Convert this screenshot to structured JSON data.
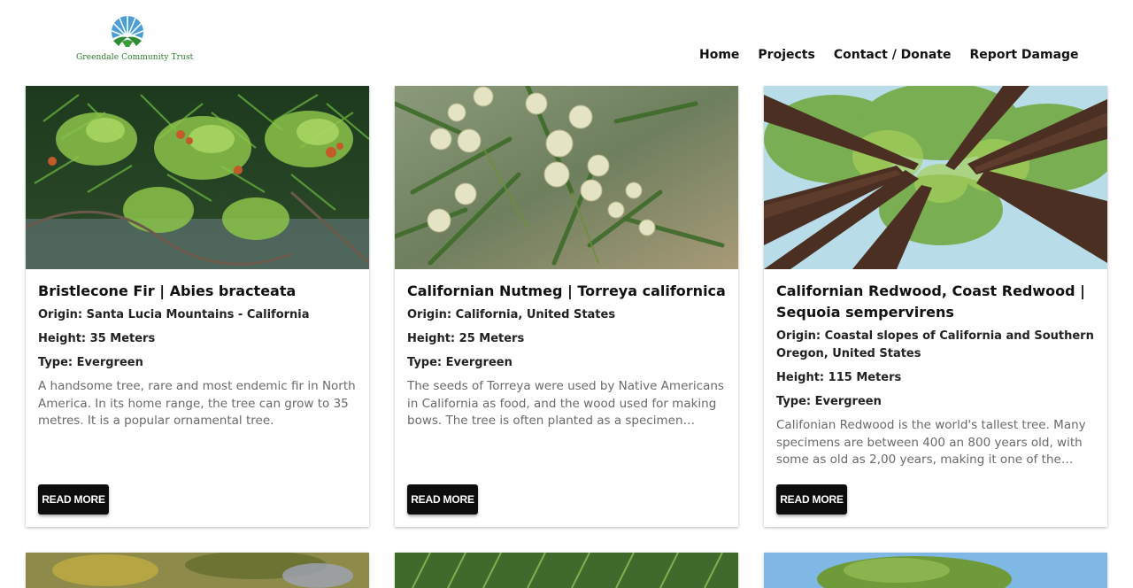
{
  "brand": {
    "logo_text": "Greendale Community Trust"
  },
  "nav": {
    "items": [
      {
        "label": "Home"
      },
      {
        "label": "Projects"
      },
      {
        "label": "Contact / Donate"
      },
      {
        "label": "Report Damage"
      }
    ]
  },
  "cards": [
    {
      "title": "Bristlecone Fir | Abies bracteata",
      "origin": "Origin: Santa Lucia Mountains - California",
      "height": "Height: 35 Meters",
      "type": "Type: Evergreen",
      "description": "A handsome tree, rare and most endemic fir in North America. In its home range, the tree can grow to 35 metres. It is a popular ornamental tree.",
      "button": "READ MORE"
    },
    {
      "title": "Californian Nutmeg | Torreya californica",
      "origin": "Origin: California, United States",
      "height": "Height: 25 Meters",
      "type": "Type: Evergreen",
      "description": "The seeds of Torreya were used by Native Americans in California as food, and the wood used for making bows. The tree is often planted as a specimen ornamental tree in parks and gardens.",
      "button": "READ MORE"
    },
    {
      "title": "Californian Redwood, Coast Redwood | Sequoia sempervirens",
      "origin": "Origin: Coastal slopes of California and Southern Oregon, United States",
      "height": "Height: 115 Meters",
      "type": "Type: Evergreen",
      "description": "Califonian Redwood is the world's tallest tree. Many specimens are between 400 an 800 years old, with some as old as 2,00 years, making it one of the oldest living organisms on Earth.",
      "button": "READ MORE"
    }
  ]
}
